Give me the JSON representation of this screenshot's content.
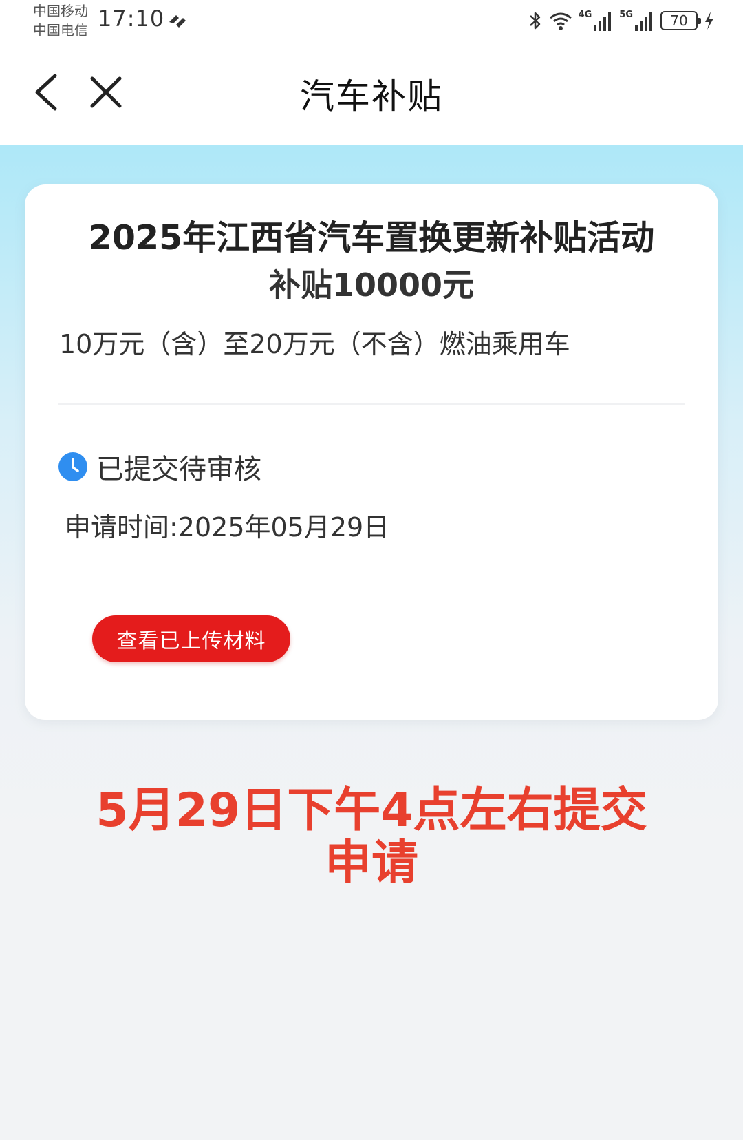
{
  "status_bar": {
    "carrier_1": "中国移动",
    "carrier_2": "中国电信",
    "time": "17:10",
    "signal_1_label": "4G",
    "signal_2_label": "5G",
    "battery": "70"
  },
  "nav": {
    "title": "汽车补贴",
    "back_icon": "chevron-left-icon",
    "close_icon": "close-icon"
  },
  "card": {
    "title": "2025年江西省汽车置换更新补贴活动",
    "amount": "补贴10000元",
    "description": "10万元（含）至20万元（不含）燃油乘用车",
    "status_icon": "clock-icon",
    "status_text": "已提交待审核",
    "apply_time": "申请时间:2025年05月29日",
    "view_button_label": "查看已上传材料"
  },
  "annotation": {
    "line1": "5月29日下午4点左右提交",
    "line2": "申请"
  },
  "colors": {
    "button_red": "#e41c1c",
    "annotation_red": "#e8402e",
    "clock_blue": "#2f8ef0",
    "header_gradient_top": "#aee8f8"
  }
}
